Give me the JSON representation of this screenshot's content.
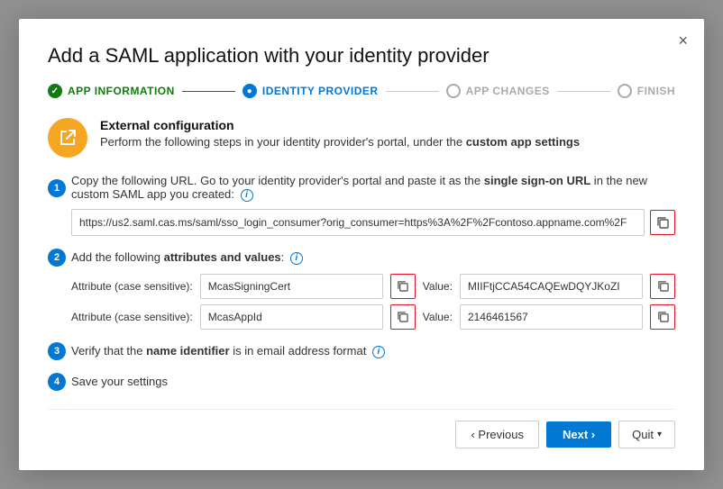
{
  "modal": {
    "title": "Add a SAML application with your identity provider",
    "close_label": "×"
  },
  "stepper": {
    "steps": [
      {
        "id": "app-info",
        "label": "APP INFORMATION",
        "state": "completed"
      },
      {
        "id": "identity-provider",
        "label": "IDENTITY PROVIDER",
        "state": "active"
      },
      {
        "id": "app-changes",
        "label": "APP CHANGES",
        "state": "inactive"
      },
      {
        "id": "finish",
        "label": "FINISH",
        "state": "inactive"
      }
    ]
  },
  "ext_config": {
    "icon": "↗",
    "title": "External configuration",
    "description_prefix": "Perform the following steps in your identity provider's portal, under the ",
    "description_bold": "custom app settings"
  },
  "steps": [
    {
      "num": "1",
      "text_prefix": "Copy the following URL. Go to your identity provider's portal and paste it as the ",
      "text_bold": "single sign-on URL",
      "text_suffix": " in the new custom SAML app you created:",
      "has_info": true,
      "url": "https://us2.saml.cas.ms/saml/sso_login_consumer?orig_consumer=https%3A%2F%2Fcontoso.appname.com%2F"
    },
    {
      "num": "2",
      "text_prefix": "Add the following ",
      "text_bold": "attributes and values",
      "text_suffix": ":",
      "has_info": true,
      "attributes": [
        {
          "attr_label": "Attribute (case sensitive):",
          "attr_value": "McasSigningCert",
          "value_label": "Value:",
          "value_value": "MIIFtjCCA54CAQEwDQYJKoZI"
        },
        {
          "attr_label": "Attribute (case sensitive):",
          "attr_value": "McasAppId",
          "value_label": "Value:",
          "value_value": "2146461567"
        }
      ]
    },
    {
      "num": "3",
      "text_prefix": "Verify that the ",
      "text_bold": "name identifier",
      "text_suffix": " is in email address format",
      "has_info": true
    },
    {
      "num": "4",
      "text": "Save your settings",
      "has_info": false
    }
  ],
  "footer": {
    "prev_label": "‹ Previous",
    "next_label": "Next ›",
    "quit_label": "Quit",
    "quit_chevron": "▾"
  }
}
